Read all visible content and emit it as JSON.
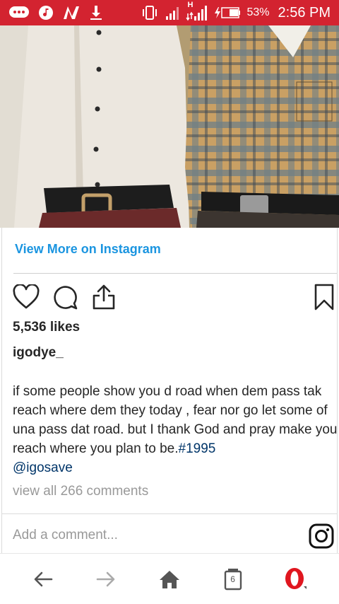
{
  "status_bar": {
    "left_icons": [
      "messages-icon",
      "music-icon",
      "nfc-icon",
      "download-icon"
    ],
    "right_icons": [
      "vibrate-icon",
      "signal-icon",
      "signal-hspa-icon",
      "battery-charging-icon"
    ],
    "network_label": "H",
    "battery_percent": "53%",
    "time": "2:56 PM",
    "color": "#d32330"
  },
  "embed": {
    "view_more_label": "View More on Instagram",
    "likes": "5,536 likes",
    "username": "igodye_",
    "caption_text": "if some people show you d road when dem pass tak reach where dem they today , fear nor go let some of una pass dat road. but I thank God and pray make you reach where you plan to be.",
    "hashtag": "#1995",
    "mention": "@igosave",
    "view_comments": "view all 266 comments",
    "add_comment_placeholder": "Add a comment...",
    "link_color": "#1b95e0",
    "tag_color": "#003569"
  },
  "bottom_nav": {
    "tab_count": "6",
    "items": [
      "back-icon",
      "forward-icon",
      "home-icon",
      "tabs-icon",
      "opera-menu-icon"
    ]
  }
}
